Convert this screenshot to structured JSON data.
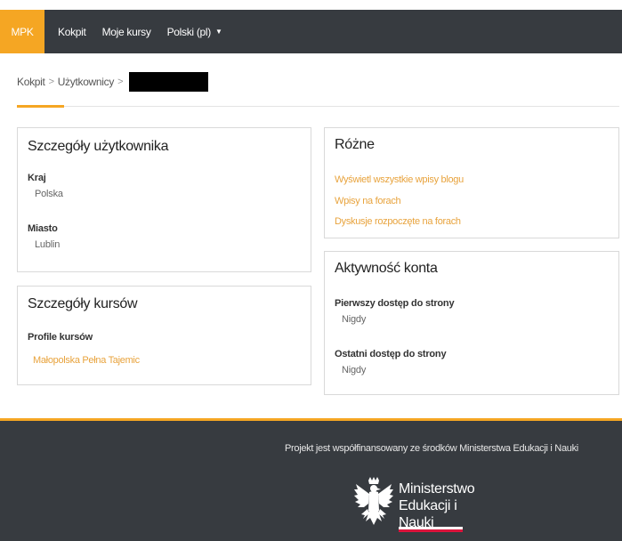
{
  "navbar": {
    "brand": "MPK",
    "items": [
      {
        "label": "Kokpit"
      },
      {
        "label": "Moje kursy"
      },
      {
        "label": "Polski (pl)"
      }
    ]
  },
  "breadcrumb": {
    "items": [
      "Kokpit",
      "Użytkownicy"
    ]
  },
  "user_details": {
    "title": "Szczegóły użytkownika",
    "fields": [
      {
        "label": "Kraj",
        "value": "Polska"
      },
      {
        "label": "Miasto",
        "value": "Lublin"
      }
    ]
  },
  "course_details": {
    "title": "Szczegóły kursów",
    "label": "Profile kursów",
    "courses": [
      "Małopolska Pełna Tajemic"
    ]
  },
  "misc": {
    "title": "Różne",
    "links": [
      "Wyświetl wszystkie wpisy blogu",
      "Wpisy na forach",
      "Dyskusje rozpoczęte na forach"
    ]
  },
  "activity": {
    "title": "Aktywność konta",
    "fields": [
      {
        "label": "Pierwszy dostęp do strony",
        "value": "Nigdy"
      },
      {
        "label": "Ostatni dostęp do strony",
        "value": "Nigdy"
      }
    ]
  },
  "footer": {
    "text": "Projekt jest współfinansowany ze środków Ministerstwa Edukacji i Nauki",
    "ministry_line1": "Ministerstwo",
    "ministry_line2": "Edukacji i Nauki"
  },
  "colors": {
    "accent": "#f5a623",
    "navbar": "#373b40",
    "link": "#e8a33d"
  }
}
